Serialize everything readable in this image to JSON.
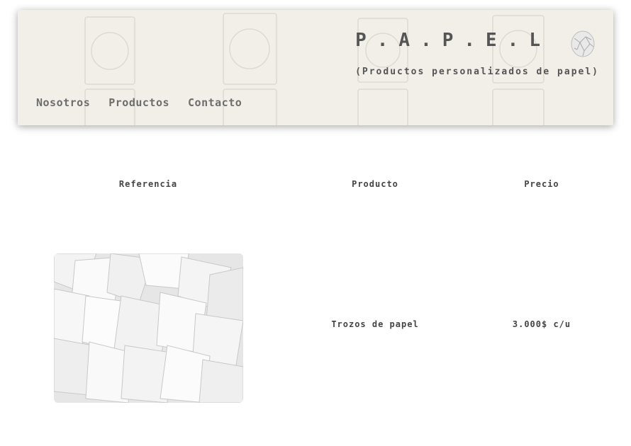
{
  "header": {
    "brand_title": "P.A.P.E.L",
    "brand_subtitle": "(Productos personalizados de papel)",
    "logo_icon": "paper-ball-icon"
  },
  "nav": {
    "items": [
      {
        "label": "Nosotros"
      },
      {
        "label": "Productos"
      },
      {
        "label": "Contacto"
      }
    ]
  },
  "table": {
    "headers": {
      "reference": "Referencia",
      "product": "Producto",
      "price": "Precio"
    },
    "rows": [
      {
        "image_icon": "torn-paper-pieces-image",
        "product": "Trozos de papel",
        "price": "3.000$ c/u"
      }
    ]
  },
  "colors": {
    "header_bg": "#f2efe9",
    "text": "#444444",
    "nav_text": "#6d6d6d"
  }
}
